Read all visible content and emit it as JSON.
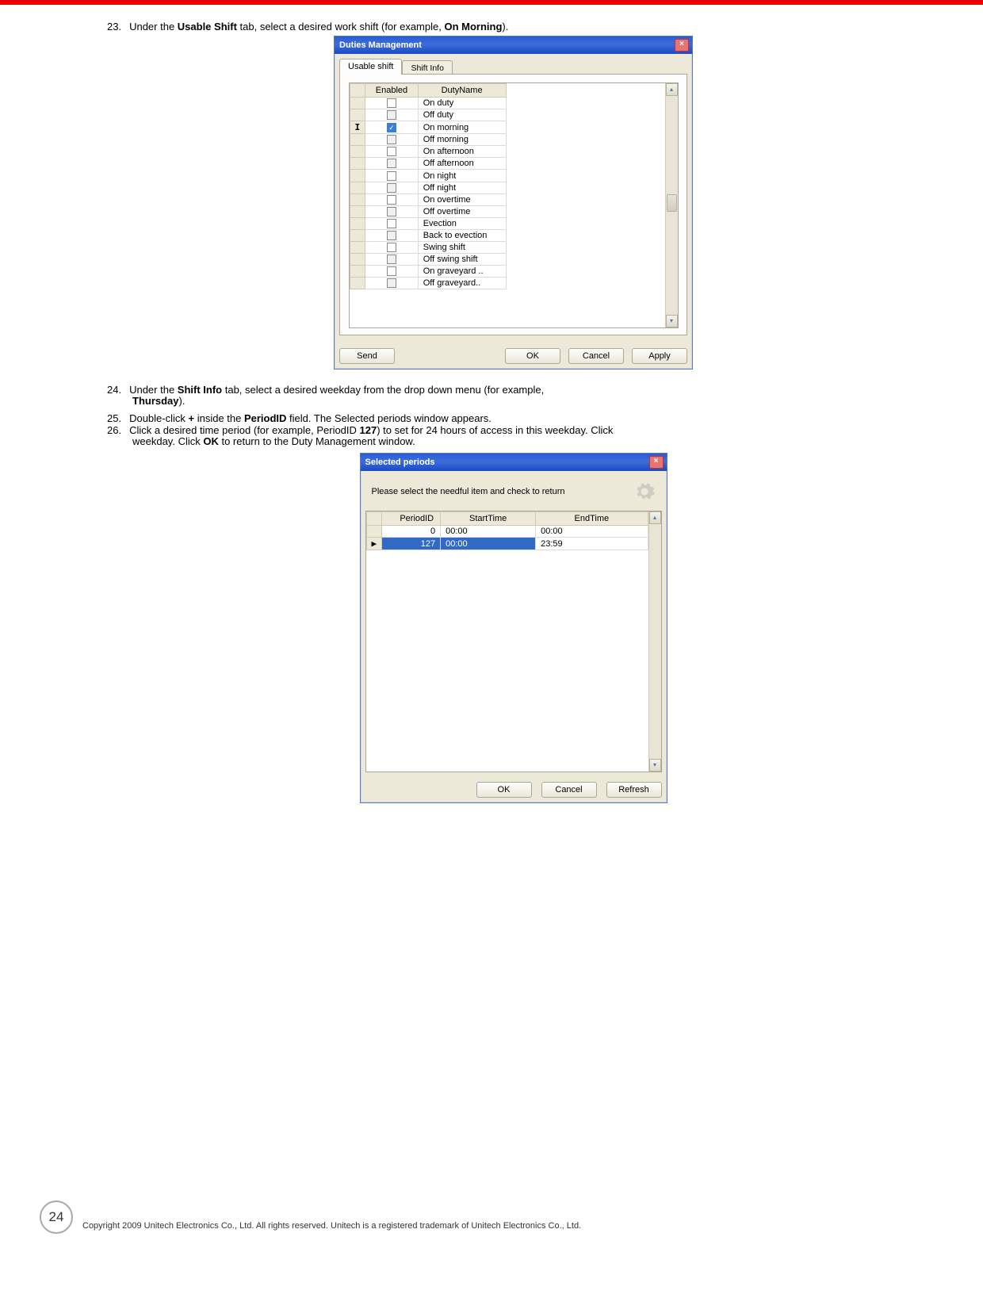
{
  "instructions": {
    "i23": {
      "num": "23.",
      "pre": "Under the ",
      "b1": "Usable Shift",
      "mid": " tab, select a desired work shift (for example, ",
      "b2": "On Morning",
      "post": ")."
    },
    "i24": {
      "num": "24.",
      "pre": "Under the ",
      "b1": "Shift Info",
      "mid": " tab, select a desired weekday from the drop down menu (for example, ",
      "b2": "Thursday",
      "post": ")."
    },
    "i25": {
      "num": "25.",
      "pre": "Double-click ",
      "b1": "+",
      "mid": " inside the ",
      "b2": "PeriodID",
      "post": " field. The Selected periods window appears."
    },
    "i26": {
      "num": "26.",
      "pre": "Click a desired time period (for example, PeriodID ",
      "b1": "127",
      "mid": ") to set for 24 hours of access in this weekday. Click ",
      "b2": "OK",
      "post": " to return to the Duty Management window."
    }
  },
  "dialog1": {
    "title": "Duties Management",
    "tabs": {
      "t0": "Usable shift",
      "t1": "Shift Info"
    },
    "columns": {
      "c0": "Enabled",
      "c1": "DutyName"
    },
    "rows": [
      {
        "checked": false,
        "alt": false,
        "name": "On duty",
        "selected": false
      },
      {
        "checked": false,
        "alt": true,
        "name": "Off duty",
        "selected": false
      },
      {
        "checked": true,
        "alt": false,
        "name": "On morning",
        "selected": true
      },
      {
        "checked": false,
        "alt": true,
        "name": "Off morning",
        "selected": false
      },
      {
        "checked": false,
        "alt": false,
        "name": "On afternoon",
        "selected": false
      },
      {
        "checked": false,
        "alt": true,
        "name": "Off afternoon",
        "selected": false
      },
      {
        "checked": false,
        "alt": false,
        "name": "On night",
        "selected": false
      },
      {
        "checked": false,
        "alt": true,
        "name": "Off night",
        "selected": false
      },
      {
        "checked": false,
        "alt": false,
        "name": "On overtime",
        "selected": false
      },
      {
        "checked": false,
        "alt": true,
        "name": "Off overtime",
        "selected": false
      },
      {
        "checked": false,
        "alt": false,
        "name": "Evection",
        "selected": false
      },
      {
        "checked": false,
        "alt": true,
        "name": "Back to evection",
        "selected": false
      },
      {
        "checked": false,
        "alt": false,
        "name": "Swing shift",
        "selected": false
      },
      {
        "checked": false,
        "alt": true,
        "name": "Off swing shift",
        "selected": false
      },
      {
        "checked": false,
        "alt": false,
        "name": "On graveyard ..",
        "selected": false
      },
      {
        "checked": false,
        "alt": true,
        "name": "Off graveyard..",
        "selected": false
      }
    ],
    "buttons": {
      "send": "Send",
      "ok": "OK",
      "cancel": "Cancel",
      "apply": "Apply"
    }
  },
  "dialog2": {
    "title": "Selected periods",
    "hint": "Please select the needful item and check to return",
    "columns": {
      "c0": "PeriodID",
      "c1": "StartTime",
      "c2": "EndTime"
    },
    "rows": [
      {
        "id": "0",
        "start": "00:00",
        "end": "00:00",
        "selected": false
      },
      {
        "id": "127",
        "start": "00:00",
        "end": "23:59",
        "selected": true
      }
    ],
    "buttons": {
      "ok": "OK",
      "cancel": "Cancel",
      "refresh": "Refresh"
    }
  },
  "footer": {
    "page": "24",
    "copyright": "Copyright 2009 Unitech Electronics Co., Ltd. All rights reserved. Unitech is a registered trademark of Unitech Electronics Co., Ltd."
  }
}
